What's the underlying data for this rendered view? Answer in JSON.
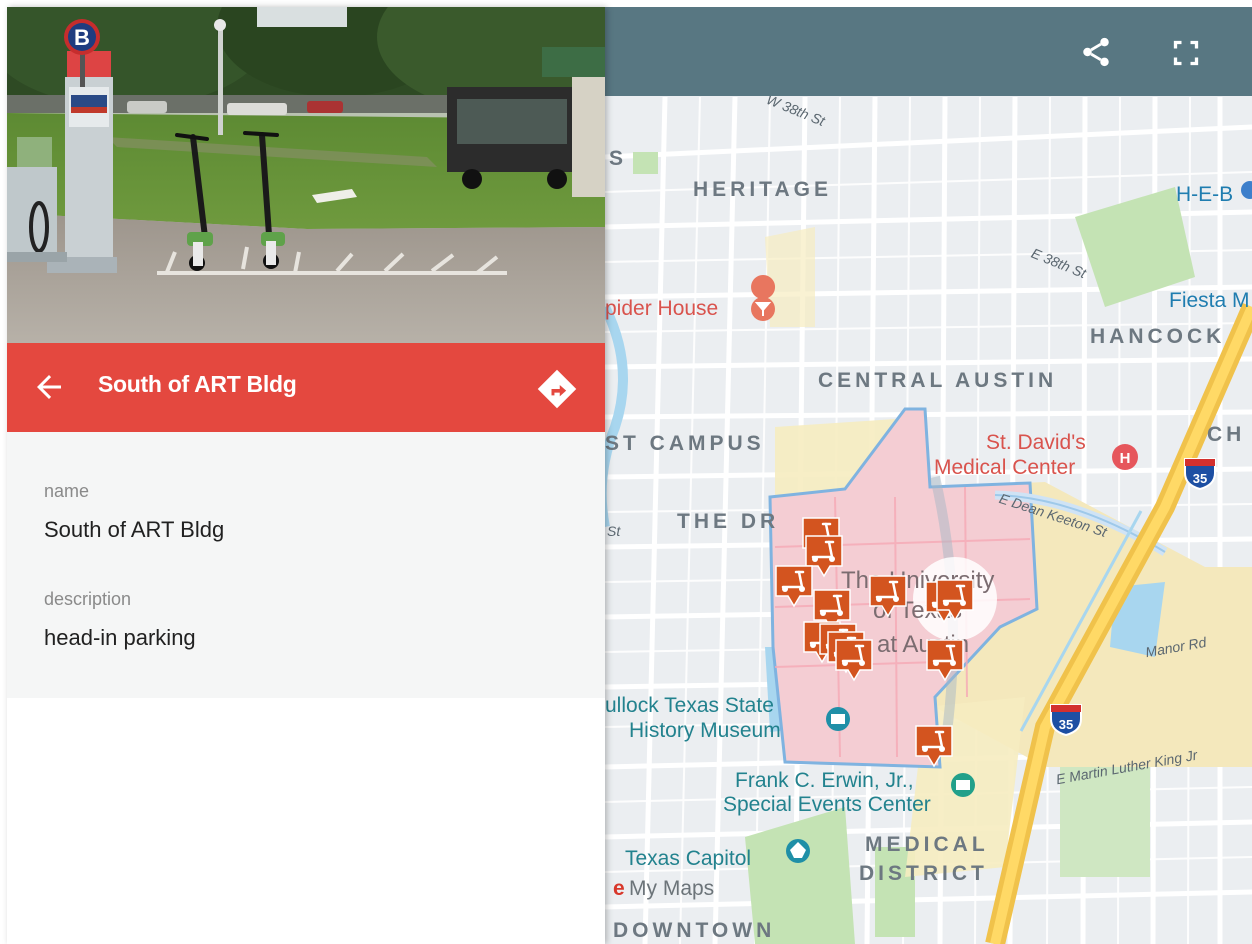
{
  "place": {
    "title": "South of ART Bldg",
    "fields": [
      {
        "label": "name",
        "value": "South of ART Bldg"
      },
      {
        "label": "description",
        "value": "head-in parking"
      }
    ],
    "photo": {
      "sign_letter": "B"
    }
  },
  "icons": {
    "back": "arrow-left-icon",
    "directions": "directions-icon",
    "share": "share-icon",
    "fullscreen": "fullscreen-icon",
    "marker": "scooter-marker-icon"
  },
  "map": {
    "neighborhoods": [
      "HERITAGE",
      "HANCOCK",
      "CENTRAL AUSTIN",
      "ST CAMPUS",
      "THE DR",
      "MEDICAL",
      "DISTRICT",
      "DOWNTOWN",
      "CH"
    ],
    "pois": [
      "pider House",
      "St. David's",
      "Medical Center",
      "ullock Texas State",
      "History Museum",
      "Frank C. Erwin, Jr.,",
      "Special Events Center",
      "Texas Capitol",
      "H-E-B",
      "Fiesta M"
    ],
    "campus_label": [
      "The University",
      "of Texas",
      "at Austin"
    ],
    "streets": [
      "W 38th St",
      "E 38th St",
      "E Dean Keeton St",
      "Manor Rd",
      "E Martin Luther King Jr",
      "St",
      "S"
    ],
    "highway_shield": "35",
    "brand": "e",
    "brand_text": "My Maps",
    "marker_count": 12
  },
  "colors": {
    "accent": "#e4483f",
    "toolbar": "#587782",
    "marker": "#d3541f",
    "campus": "#f4cdd3"
  }
}
